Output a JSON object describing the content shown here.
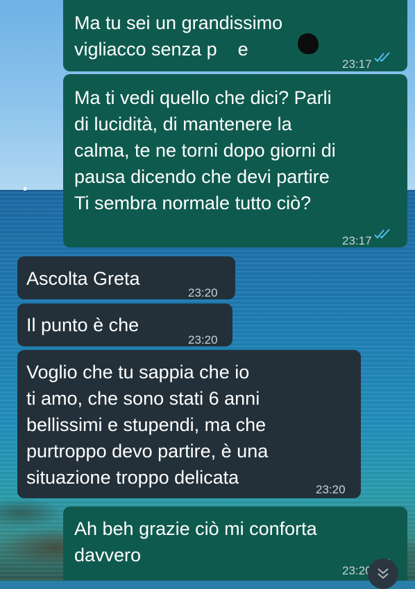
{
  "chat": {
    "messages": [
      {
        "direction": "out",
        "lines": [
          "Ma tu sei un grandissimo",
          "vigliacco senza p    e"
        ],
        "time": "23:17",
        "status": "read"
      },
      {
        "direction": "out",
        "lines": [
          "Ma ti vedi quello che dici? Parli",
          "di lucidità, di mantenere la",
          "calma, te ne torni dopo giorni di",
          "pausa dicendo che devi partire",
          "Ti sembra normale tutto ciò?"
        ],
        "time": "23:17",
        "status": "read"
      },
      {
        "direction": "in",
        "lines": [
          "Ascolta Greta"
        ],
        "time": "23:20"
      },
      {
        "direction": "in",
        "lines": [
          "Il punto è che"
        ],
        "time": "23:20"
      },
      {
        "direction": "in",
        "lines": [
          "Voglio che tu sappia che io",
          "ti amo, che sono stati 6 anni",
          "bellissimi e stupendi, ma che",
          "purtroppo devo partire, è una",
          "situazione troppo delicata"
        ],
        "time": "23:20"
      },
      {
        "direction": "out",
        "lines": [
          "Ah beh grazie ciò mi conforta",
          "davvero"
        ],
        "time": "23:20",
        "status": "read"
      }
    ]
  },
  "icons": {
    "read_receipt": "double-check-icon",
    "scroll_down": "double-chevron-down-icon"
  },
  "colors": {
    "outgoing_bubble": "#0f5a4e",
    "incoming_bubble": "#23303a",
    "read_tick": "#53bdeb"
  }
}
